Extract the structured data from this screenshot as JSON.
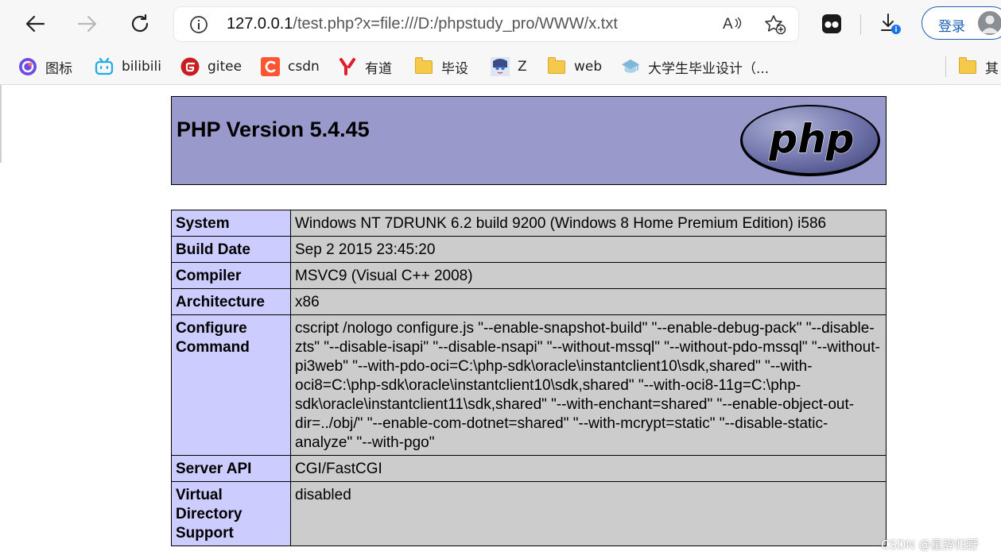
{
  "browser": {
    "url_host": "127.0.0.1",
    "url_path": "/test.php?x=file:///D:/phpstudy_pro/WWW/x.txt",
    "read_aloud": "A",
    "login_label": "登录"
  },
  "bookmarks": [
    {
      "label": "图标",
      "icon": "app-icon"
    },
    {
      "label": "bilibili",
      "icon": "bilibili-icon"
    },
    {
      "label": "gitee",
      "icon": "gitee-icon"
    },
    {
      "label": "csdn",
      "icon": "csdn-icon"
    },
    {
      "label": "有道",
      "icon": "youdao-icon"
    },
    {
      "label": "毕设",
      "icon": "folder-icon"
    },
    {
      "label": "Z",
      "icon": "avatar-icon"
    },
    {
      "label": "web",
      "icon": "folder-icon"
    },
    {
      "label": "大学生毕业设计（...",
      "icon": "school-icon"
    },
    {
      "label": "其",
      "icon": "folder-icon"
    }
  ],
  "php": {
    "version_title": "PHP Version 5.4.45",
    "logo_text": "php"
  },
  "info_rows": [
    {
      "key": "System",
      "value": "Windows NT 7DRUNK 6.2 build 9200 (Windows 8 Home Premium Edition) i586"
    },
    {
      "key": "Build Date",
      "value": "Sep 2 2015 23:45:20"
    },
    {
      "key": "Compiler",
      "value": "MSVC9 (Visual C++ 2008)"
    },
    {
      "key": "Architecture",
      "value": "x86"
    },
    {
      "key": "Configure Command",
      "value": "cscript /nologo configure.js \"--enable-snapshot-build\" \"--enable-debug-pack\" \"--disable-zts\" \"--disable-isapi\" \"--disable-nsapi\" \"--without-mssql\" \"--without-pdo-mssql\" \"--without-pi3web\" \"--with-pdo-oci=C:\\php-sdk\\oracle\\instantclient10\\sdk,shared\" \"--with-oci8=C:\\php-sdk\\oracle\\instantclient10\\sdk,shared\" \"--with-oci8-11g=C:\\php-sdk\\oracle\\instantclient11\\sdk,shared\" \"--with-enchant=shared\" \"--enable-object-out-dir=../obj/\" \"--enable-com-dotnet=shared\" \"--with-mcrypt=static\" \"--disable-static-analyze\" \"--with-pgo\""
    },
    {
      "key": "Server API",
      "value": "CGI/FastCGI"
    },
    {
      "key": "Virtual Directory Support",
      "value": "disabled"
    }
  ],
  "watermark": "CSDN @星辞归野",
  "colors": {
    "header_bg": "#9999cc",
    "key_bg": "#ccccff",
    "value_bg": "#cccccc",
    "accent": "#1a5fb4"
  }
}
